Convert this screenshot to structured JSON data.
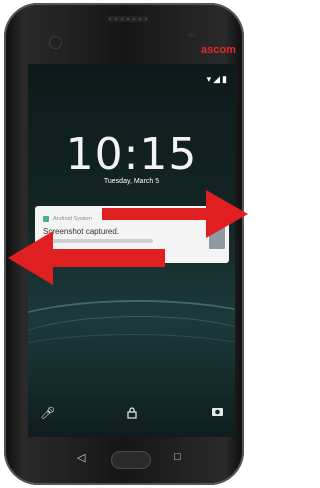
{
  "device": {
    "brand": "ascom"
  },
  "lockscreen": {
    "time": "10:15",
    "date": "Tuesday, March 5",
    "notification": {
      "app": "Android System",
      "title": "Screenshot captured."
    }
  },
  "status_icons": [
    "wifi-icon",
    "signal-icon",
    "battery-icon"
  ],
  "bottom_icons": [
    "mic-icon",
    "lock-icon",
    "camera-icon"
  ],
  "nav_icons": [
    "back-icon",
    "home-button",
    "recents-icon"
  ],
  "annotations": {
    "arrow_color": "#e02020",
    "arrows": [
      "swipe-right-arrow",
      "swipe-left-arrow"
    ]
  },
  "colors": {
    "brand_red": "#e32a2a"
  }
}
